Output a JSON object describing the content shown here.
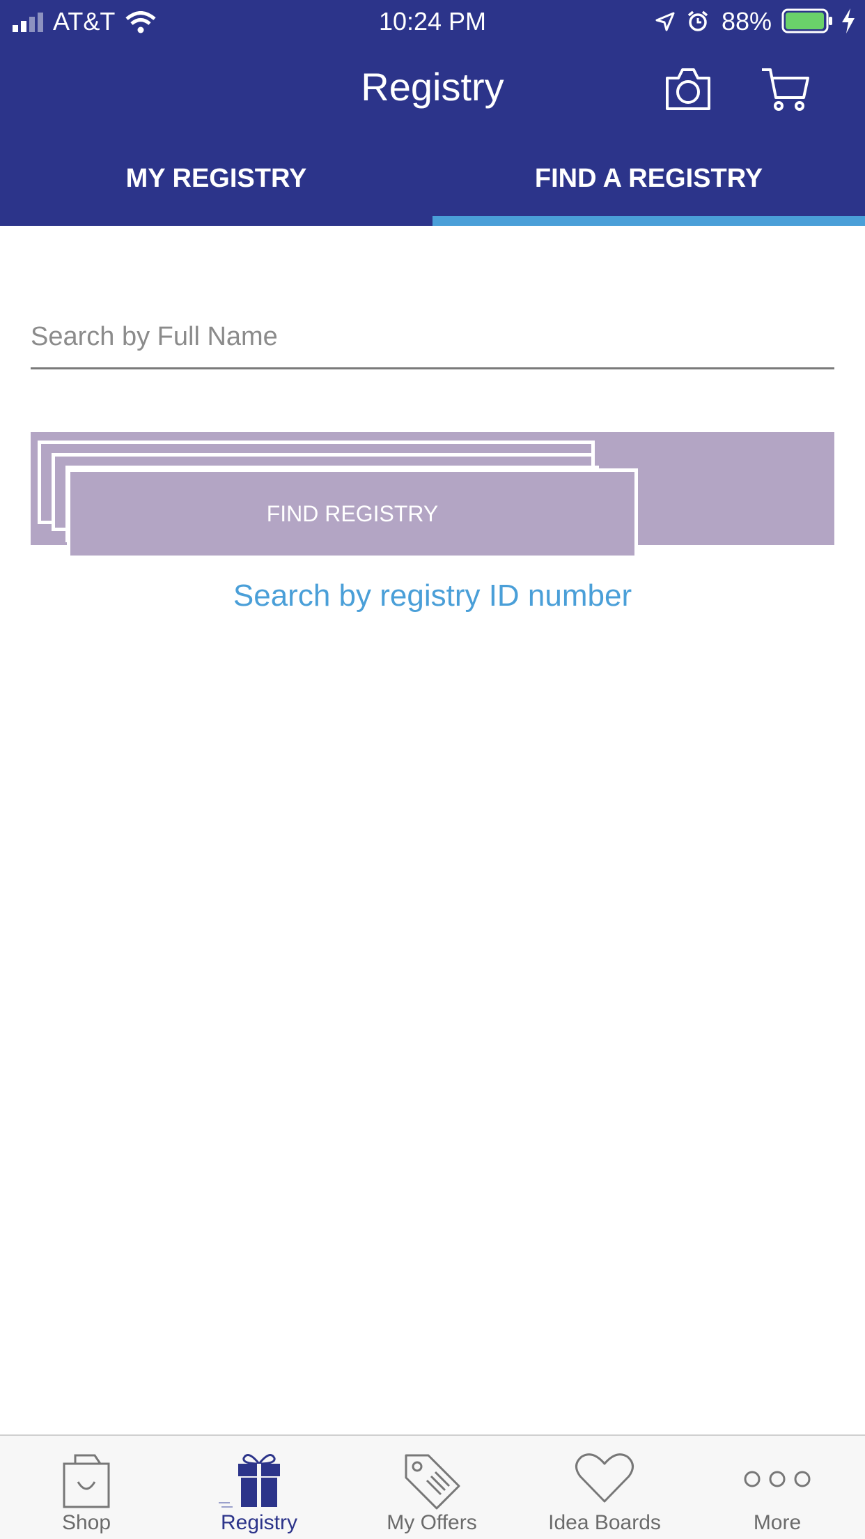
{
  "status_bar": {
    "carrier": "AT&T",
    "time": "10:24 PM",
    "battery": "88%"
  },
  "header": {
    "title": "Registry",
    "icons": [
      "camera-icon",
      "cart-icon"
    ]
  },
  "tabs": [
    {
      "label": "MY REGISTRY",
      "active": false
    },
    {
      "label": "FIND A REGISTRY",
      "active": true
    }
  ],
  "search": {
    "placeholder": "Search by Full Name",
    "value": ""
  },
  "find_button": {
    "label": "FIND REGISTRY"
  },
  "id_link": {
    "label": "Search by registry ID number"
  },
  "bottom_nav": [
    {
      "label": "Shop",
      "icon": "shopping-bag-icon",
      "active": false
    },
    {
      "label": "Registry",
      "icon": "gift-icon",
      "active": true
    },
    {
      "label": "My Offers",
      "icon": "tag-icon",
      "active": false
    },
    {
      "label": "Idea Boards",
      "icon": "heart-icon",
      "active": false
    },
    {
      "label": "More",
      "icon": "more-icon",
      "active": false
    }
  ],
  "colors": {
    "brand": "#2c348a",
    "accent": "#4a9fd8",
    "button": "#b3a5c4"
  }
}
